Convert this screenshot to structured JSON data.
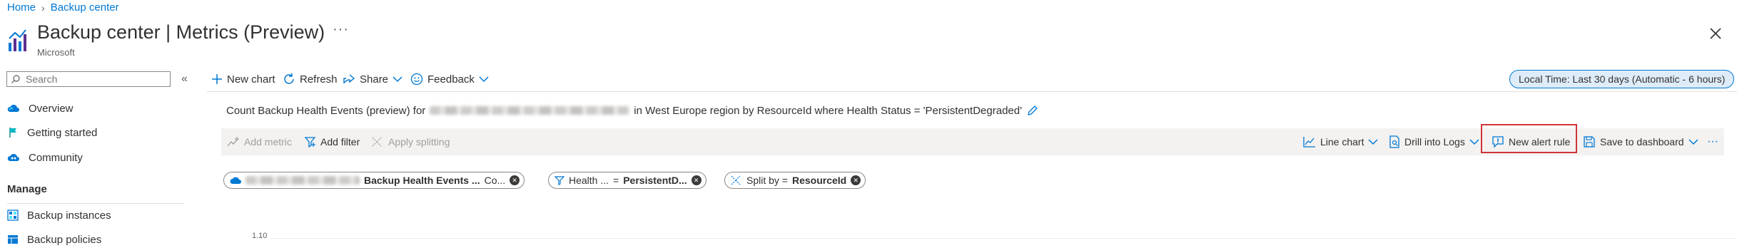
{
  "breadcrumb": {
    "home": "Home",
    "current": "Backup center"
  },
  "header": {
    "title_main": "Backup center",
    "title_sep": "|",
    "title_sub": "Metrics (Preview)",
    "ellipsis": "···",
    "publisher": "Microsoft"
  },
  "toolbar": {
    "new_chart": "New chart",
    "refresh": "Refresh",
    "share": "Share",
    "feedback": "Feedback",
    "time_range": "Local Time: Last 30 days (Automatic - 6 hours)"
  },
  "sidebar": {
    "search_placeholder": "Search",
    "collapse": "«",
    "items": [
      {
        "label": "Overview",
        "icon": "cloud-icon"
      },
      {
        "label": "Getting started",
        "icon": "flag-icon"
      },
      {
        "label": "Community",
        "icon": "cloud-people-icon"
      }
    ],
    "manage_heading": "Manage",
    "manage_items": [
      {
        "label": "Backup instances",
        "icon": "grid-icon"
      },
      {
        "label": "Backup policies",
        "icon": "table-icon"
      }
    ]
  },
  "chart": {
    "title_prefix": "Count Backup Health Events (preview) for",
    "title_suffix": "in West Europe region by ResourceId where Health Status = 'PersistentDegraded'",
    "y_tick_top": "1.10"
  },
  "metrics_toolbar": {
    "add_metric": "Add metric",
    "add_filter": "Add filter",
    "apply_splitting": "Apply splitting",
    "line_chart": "Line chart",
    "drill_logs": "Drill into Logs",
    "new_alert_rule": "New alert rule",
    "save_dashboard": "Save to dashboard",
    "more": "···"
  },
  "pills": {
    "metric_name": "Backup Health Events ...",
    "metric_agg": "Co...",
    "filter_name": "Health ...",
    "filter_op": "=",
    "filter_value": "PersistentD...",
    "split_prefix": "Split by =",
    "split_value": "ResourceId"
  },
  "colors": {
    "accent": "#0078d4",
    "highlight": "#d13438",
    "toolbar_bg": "#f3f2f1"
  }
}
